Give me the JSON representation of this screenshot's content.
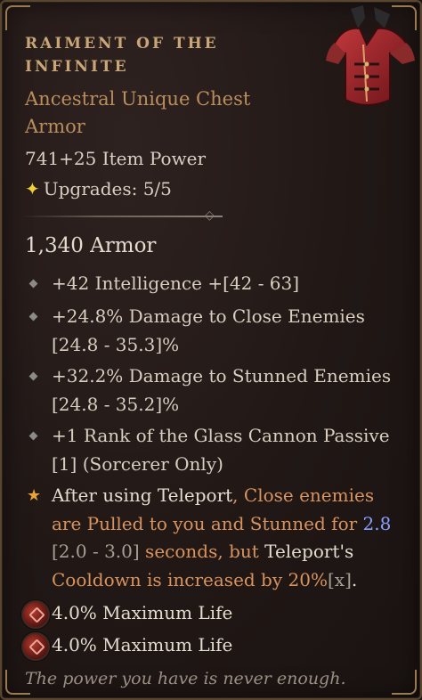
{
  "item": {
    "name_line1": "RAIMENT OF THE",
    "name_line2": "INFINITE",
    "type_line1": "Ancestral Unique Chest",
    "type_line2": "Armor",
    "item_power": "741+25 Item Power",
    "upgrades_icon": "✦",
    "upgrades": "Upgrades: 5/5",
    "armor": "1,340 Armor",
    "affixes": [
      {
        "line1": "+42 Intelligence +[42 - 63]",
        "line2": ""
      },
      {
        "line1": "+24.8% Damage to Close Enemies",
        "line2": "[24.8 - 35.3]%"
      },
      {
        "line1": "+32.2% Damage to Stunned Enemies",
        "line2": "[24.8 - 35.2]%"
      },
      {
        "line1": "+1 Rank of the Glass Cannon Passive",
        "line2": "[1] (Sorcerer Only)"
      }
    ],
    "unique_power": {
      "star_icon": "★",
      "p1": "After using ",
      "p2": "Teleport",
      "p3": ", Close enemies",
      "p4": "are Pulled to you and Stunned for ",
      "p5": "2.8",
      "p6": "[2.0 - 3.0]",
      "p7": " seconds, but ",
      "p8": "Teleport's",
      "p9": "Cooldown is increased by 20%",
      "p10": "[x]",
      "p11": "."
    },
    "sockets": [
      {
        "icon": "ruby-gem-icon",
        "text": "4.0% Maximum Life"
      },
      {
        "icon": "ruby-gem-icon",
        "text": "4.0% Maximum Life"
      }
    ],
    "flavor": "The power you have is never enough."
  },
  "colors": {
    "title": "#c8a678",
    "unique_orange": "#d9935f",
    "value_blue": "#8aa0ff",
    "upgrade_gold": "#f0cf3a"
  }
}
